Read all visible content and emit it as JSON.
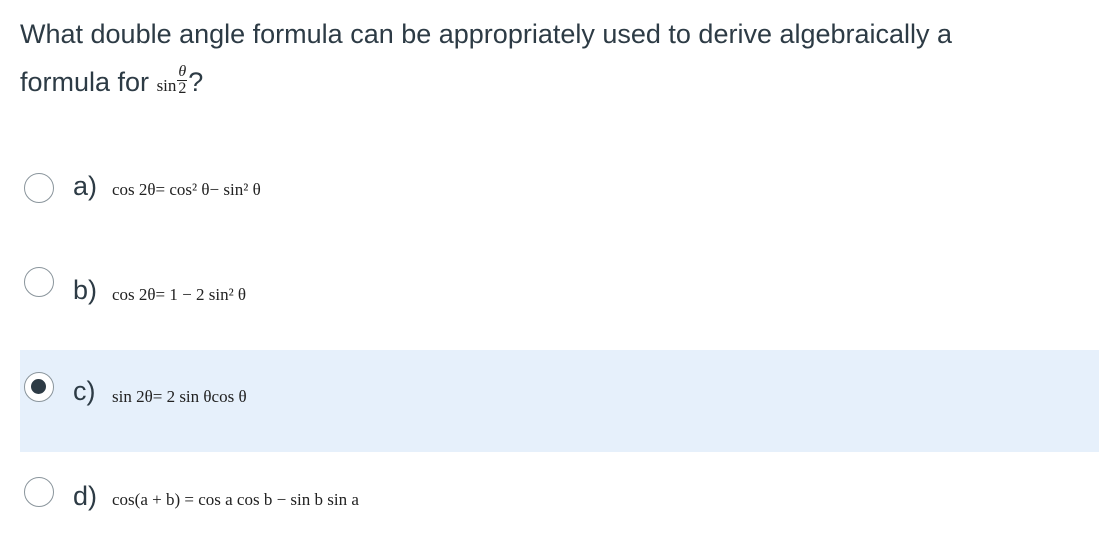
{
  "question": {
    "line1": "What double angle formula can be appropriately used to derive algebraically a",
    "line2_prefix": "formula for",
    "sin_text": "sin",
    "frac_num": "θ",
    "frac_den": "2",
    "line2_suffix": "?"
  },
  "options": [
    {
      "letter": "a)",
      "formula": "cos 2θ= cos² θ− sin² θ",
      "selected": false
    },
    {
      "letter": "b)",
      "formula": "cos 2θ= 1 − 2 sin² θ",
      "selected": false
    },
    {
      "letter": "c)",
      "formula": "sin 2θ= 2 sin θcos θ",
      "selected": true
    },
    {
      "letter": "d)",
      "formula": "cos(a + b) = cos a cos b − sin b sin a",
      "selected": false
    }
  ],
  "colors": {
    "selected_bg": "#e6f0fb",
    "text": "#2d3b45",
    "radio_border": "#8a959c"
  }
}
